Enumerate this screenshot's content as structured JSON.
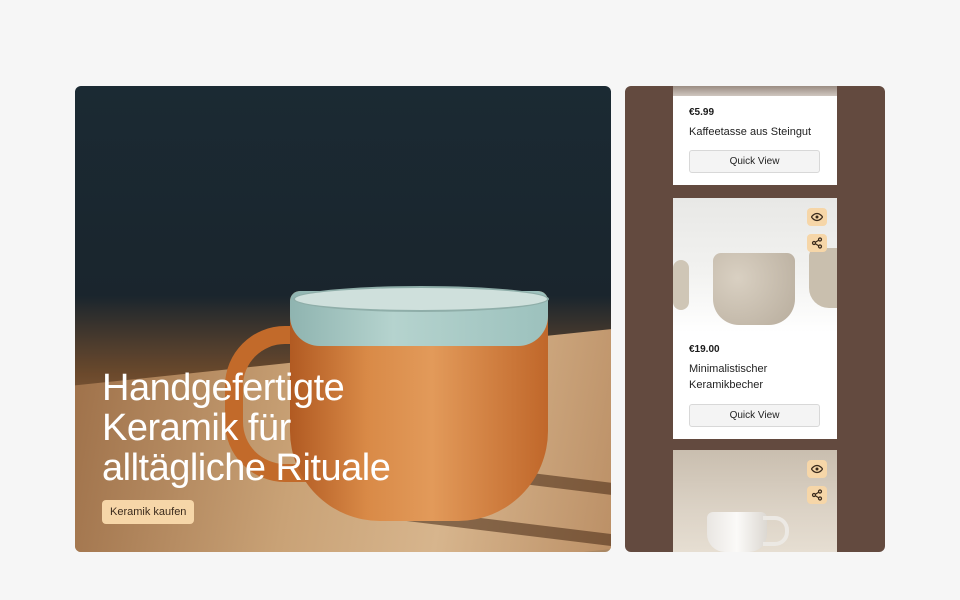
{
  "hero": {
    "title": "Handgefertigte Keramik für alltägliche Rituale",
    "cta_label": "Keramik kaufen"
  },
  "products": [
    {
      "price": "€5.99",
      "name": "Kaffeetasse aus Steingut",
      "quick_view_label": "Quick View"
    },
    {
      "price": "€19.00",
      "name": "Minimalistischer Keramikbecher",
      "quick_view_label": "Quick View"
    },
    {
      "price": "",
      "name": "",
      "quick_view_label": ""
    }
  ],
  "icons": {
    "view": "eye-icon",
    "share": "share-icon"
  },
  "colors": {
    "panel_bg": "#634a3f",
    "accent": "#f6d6a8",
    "page_bg": "#f6f6f6"
  }
}
